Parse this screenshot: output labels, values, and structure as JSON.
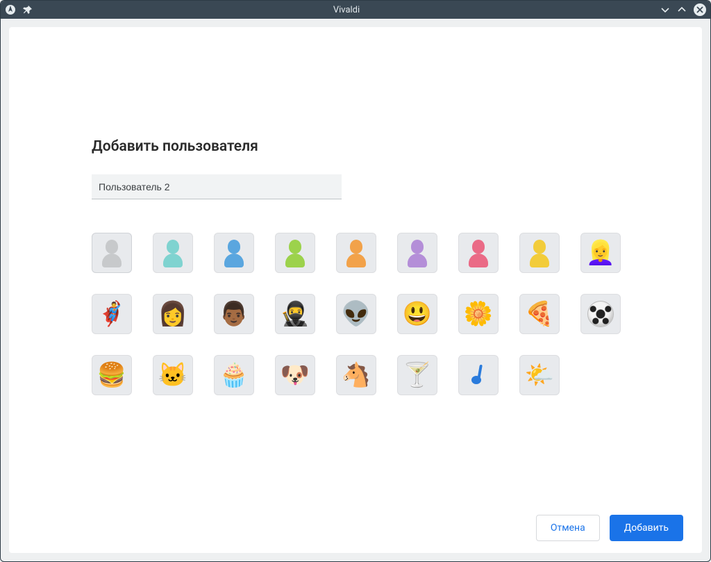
{
  "window": {
    "title": "Vivaldi"
  },
  "dialog": {
    "heading": "Добавить пользователя",
    "username": "Пользователь 2",
    "cancel_label": "Отмена",
    "submit_label": "Добавить"
  },
  "avatar_colors": {
    "grey": "#c7c9cb",
    "teal": "#7fd3d0",
    "blue": "#5aa6df",
    "green": "#9cd24c",
    "orange": "#f2a24a",
    "purple": "#b48ed8",
    "pink": "#ea6a86",
    "yellow": "#f2cc3a"
  },
  "avatars_row1": [
    {
      "id": "avatar-grey",
      "kind": "silhouette",
      "color": "grey",
      "selected": true
    },
    {
      "id": "avatar-teal",
      "kind": "silhouette",
      "color": "teal"
    },
    {
      "id": "avatar-blue",
      "kind": "silhouette",
      "color": "blue"
    },
    {
      "id": "avatar-green",
      "kind": "silhouette",
      "color": "green"
    },
    {
      "id": "avatar-orange",
      "kind": "silhouette",
      "color": "orange"
    },
    {
      "id": "avatar-purple",
      "kind": "silhouette",
      "color": "purple"
    },
    {
      "id": "avatar-pink",
      "kind": "silhouette",
      "color": "pink"
    },
    {
      "id": "avatar-yellow",
      "kind": "silhouette",
      "color": "yellow"
    },
    {
      "id": "avatar-blonde-woman",
      "kind": "emoji",
      "glyph": "👱‍♀️"
    }
  ],
  "avatars_row2": [
    {
      "id": "avatar-superhero",
      "kind": "emoji",
      "glyph": "🦸‍♂️"
    },
    {
      "id": "avatar-sunglasses-woman",
      "kind": "emoji",
      "glyph": "👩"
    },
    {
      "id": "avatar-man",
      "kind": "emoji",
      "glyph": "👨🏾"
    },
    {
      "id": "avatar-ninja",
      "kind": "emoji",
      "glyph": "🥷"
    },
    {
      "id": "avatar-alien",
      "kind": "emoji",
      "glyph": "👽"
    },
    {
      "id": "avatar-smiley",
      "kind": "emoji",
      "glyph": "😃"
    },
    {
      "id": "avatar-flower",
      "kind": "emoji",
      "glyph": "🌼"
    },
    {
      "id": "avatar-pizza",
      "kind": "emoji",
      "glyph": "🍕"
    },
    {
      "id": "avatar-soccer",
      "kind": "soccer"
    }
  ],
  "avatars_row3": [
    {
      "id": "avatar-burger",
      "kind": "emoji",
      "glyph": "🍔"
    },
    {
      "id": "avatar-cat",
      "kind": "emoji",
      "glyph": "🐱"
    },
    {
      "id": "avatar-cupcake",
      "kind": "emoji",
      "glyph": "🧁"
    },
    {
      "id": "avatar-dog",
      "kind": "emoji",
      "glyph": "🐶"
    },
    {
      "id": "avatar-horse",
      "kind": "emoji",
      "glyph": "🐴"
    },
    {
      "id": "avatar-cocktail",
      "kind": "emoji",
      "glyph": "🍸"
    },
    {
      "id": "avatar-music-note",
      "kind": "note"
    },
    {
      "id": "avatar-weather",
      "kind": "emoji",
      "glyph": "🌤️"
    }
  ]
}
